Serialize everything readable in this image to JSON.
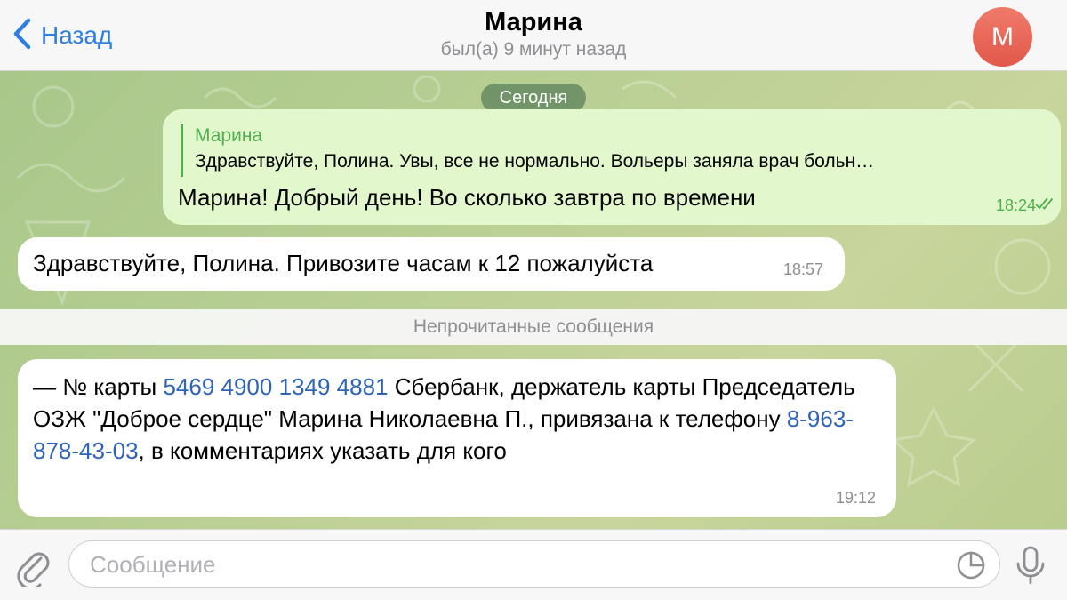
{
  "header": {
    "back_label": "Назад",
    "title": "Марина",
    "subtitle": "был(а) 9 минут назад",
    "avatar_letter": "М"
  },
  "chat": {
    "date_label": "Сегодня",
    "messages": [
      {
        "direction": "outgoing",
        "reply_to": {
          "name": "Марина",
          "text": "Здравствуйте, Полина. Увы, все не нормально. Вольеры заняла врач больн…"
        },
        "text": "Марина! Добрый день! Во сколько завтра по времени",
        "time": "18:24",
        "status": "read"
      },
      {
        "direction": "incoming",
        "text": "Здравствуйте, Полина. Привозите часам к 12 пожалуйста",
        "time": "18:57"
      }
    ],
    "unread_label": "Непрочитанные сообщения",
    "unread_message": {
      "direction": "incoming",
      "parts": {
        "p1": " — № карты ",
        "card_number": "5469 4900 1349 4881",
        "p2": " Сбербанк, держатель карты Председатель ОЗЖ \"Доброе сердце\" Марина Николаевна П., привязана к телефону ",
        "phone": "8-963-878-43-03",
        "p3": ", в комментариях указать для кого"
      },
      "time": "19:12"
    }
  },
  "input": {
    "placeholder": "Сообщение"
  },
  "colors": {
    "accent": "#2f7fe0",
    "outgoing_bubble": "#e2f7cb",
    "green_text": "#4fae4e",
    "link": "#2e63b8",
    "avatar": "#e55a4c"
  },
  "icons": [
    "chevron-left-icon",
    "paperclip-icon",
    "sticker-icon",
    "microphone-icon",
    "double-check-icon"
  ]
}
